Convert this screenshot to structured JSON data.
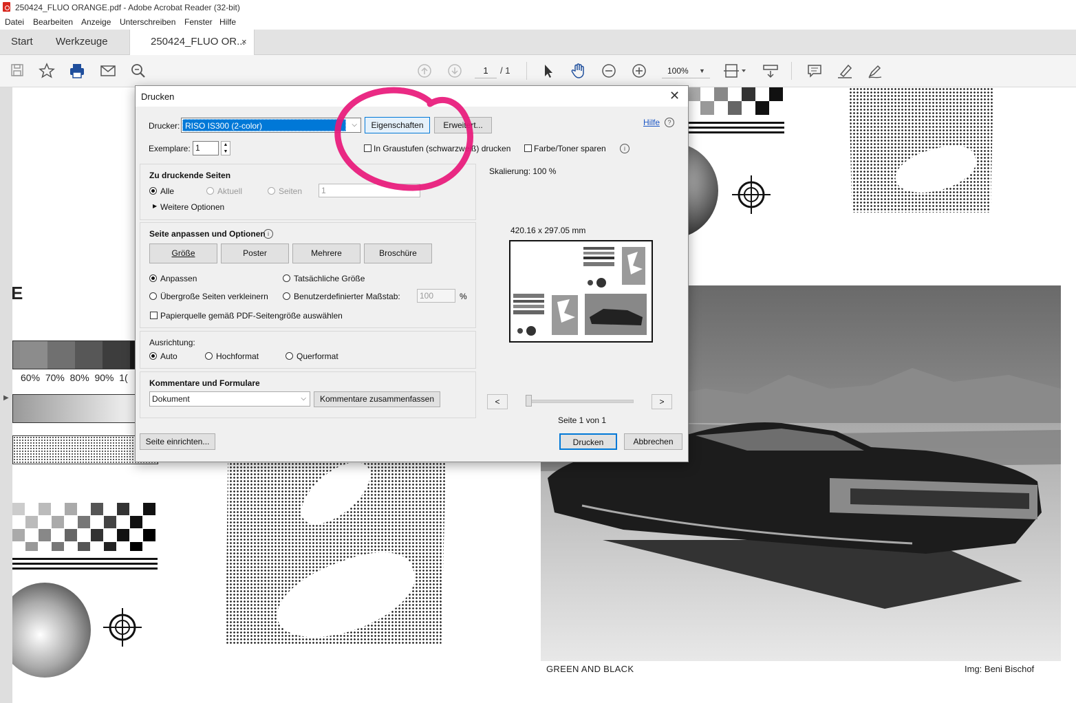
{
  "window": {
    "title": "250424_FLUO ORANGE.pdf - Adobe Acrobat Reader (32-bit)"
  },
  "menu": [
    "Datei",
    "Bearbeiten",
    "Anzeige",
    "Unterschreiben",
    "Fenster",
    "Hilfe"
  ],
  "tabs": {
    "start": "Start",
    "tools": "Werkzeuge",
    "document": "250424_FLUO OR...",
    "close": "×"
  },
  "toolbar": {
    "page_current": "1",
    "page_total": "/ 1",
    "zoom": "100%"
  },
  "document": {
    "percent_labels": [
      "60%",
      "70%",
      "80%",
      "90%",
      "1("
    ],
    "letter": "E",
    "caption_left": "GREEN AND BLACK",
    "caption_right": "Img: Beni Bischof"
  },
  "dialog": {
    "title": "Drucken",
    "printer_label": "Drucker:",
    "printer_value": "RISO IS300 (2-color)",
    "properties_button": "Eigenschaften",
    "advanced_button": "Erweitert...",
    "help_link": "Hilfe",
    "copies_label": "Exemplare:",
    "copies_value": "1",
    "grayscale_label": "In Graustufen (schwarzweiß) drucken",
    "save_toner_label": "Farbe/Toner sparen",
    "pages_section": {
      "heading": "Zu druckende Seiten",
      "all": "Alle",
      "current": "Aktuell",
      "pages": "Seiten",
      "pages_value": "1",
      "more_options": "Weitere Optionen"
    },
    "fit_section": {
      "heading": "Seite anpassen und Optionen",
      "size_button": "Größe",
      "poster_button": "Poster",
      "multiple_button": "Mehrere",
      "booklet_button": "Broschüre",
      "fit": "Anpassen",
      "actual_size": "Tatsächliche Größe",
      "shrink": "Übergroße Seiten verkleinern",
      "custom_scale": "Benutzerdefinierter Maßstab:",
      "custom_scale_value": "100",
      "percent": "%",
      "paper_source": "Papierquelle gemäß PDF-Seitengröße auswählen"
    },
    "orientation_section": {
      "heading": "Ausrichtung:",
      "auto": "Auto",
      "portrait": "Hochformat",
      "landscape": "Querformat"
    },
    "comments_section": {
      "heading": "Kommentare und Formulare",
      "select_value": "Dokument",
      "summarize_button": "Kommentare zusammenfassen"
    },
    "preview": {
      "scaling": "Skalierung: 100 %",
      "dimensions": "420.16 x 297.05 mm",
      "prev": "<",
      "next": ">",
      "page_info": "Seite 1 von 1"
    },
    "page_setup_button": "Seite einrichten...",
    "print_button": "Drucken",
    "cancel_button": "Abbrechen"
  },
  "colors": {
    "annotation": "#e8187a",
    "selection": "#0078d7",
    "printer_blue": "#1f4e9c"
  },
  "icons": [
    "pdf-icon",
    "save-icon",
    "star-icon",
    "print-icon",
    "mail-icon",
    "search-zoom-icon",
    "page-up-icon",
    "page-down-icon",
    "select-pointer-icon",
    "hand-icon",
    "zoom-out-icon",
    "zoom-in-icon",
    "page-fit-icon",
    "scroll-mode-icon",
    "comment-icon",
    "highlight-icon",
    "sign-icon",
    "info-icon",
    "chevron-down-icon",
    "close-icon"
  ]
}
